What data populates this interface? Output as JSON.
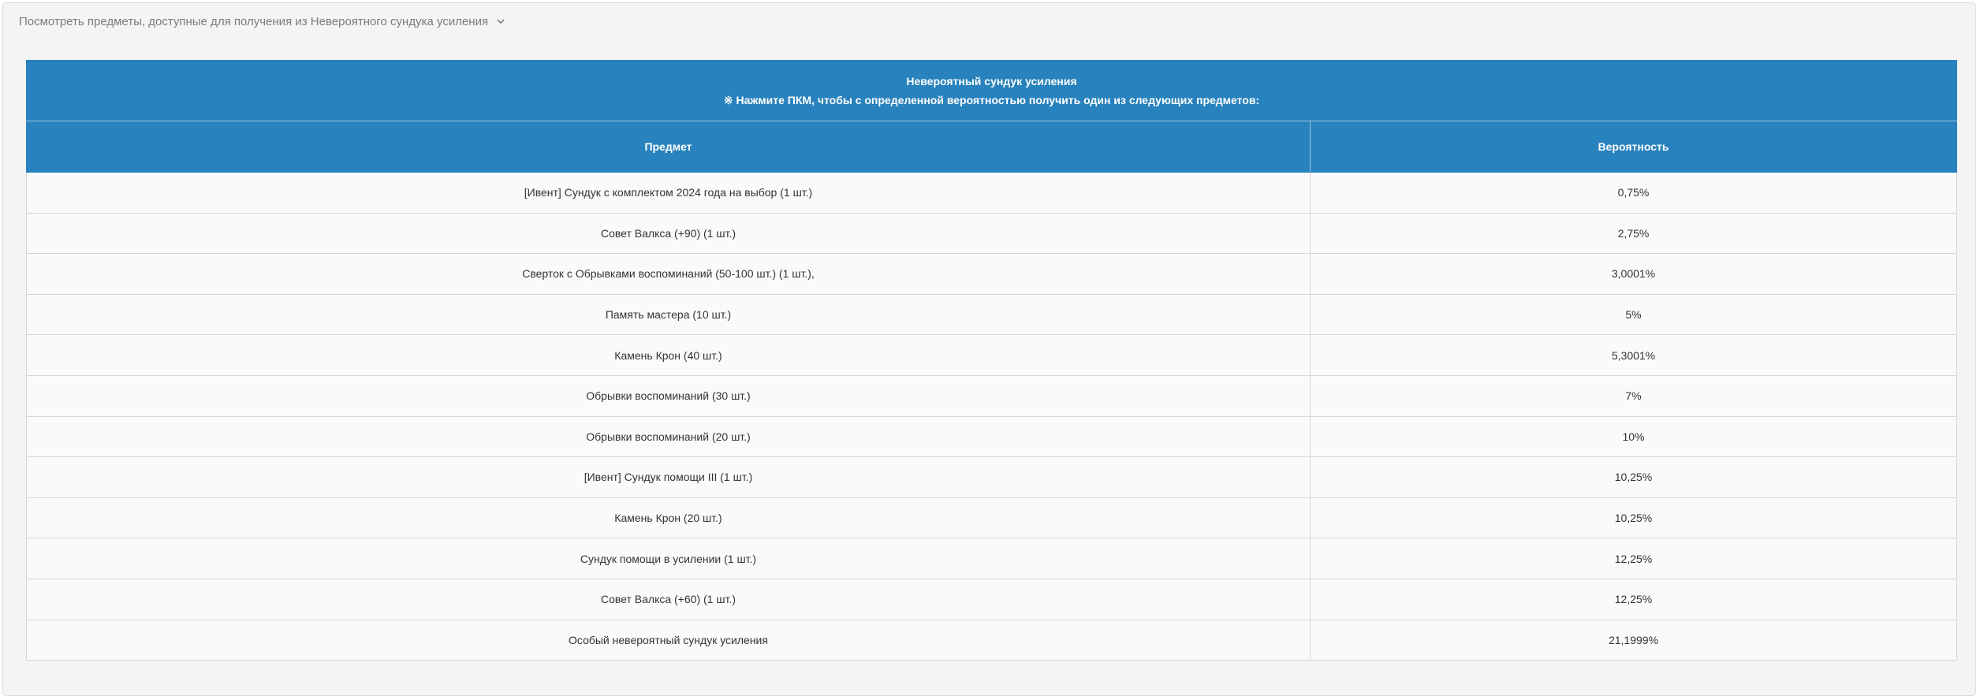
{
  "toggle": {
    "label": "Посмотреть предметы, доступные для получения из Невероятного сундука усиления",
    "icon": "chevron-down-icon"
  },
  "table": {
    "title": "Невероятный сундук усиления",
    "subtitle": "※ Нажмите ПКМ, чтобы с определенной вероятностью получить один из следующих предметов:",
    "columns": [
      "Предмет",
      "Вероятность"
    ],
    "rows": [
      {
        "item": "[Ивент] Сундук с комплектом 2024 года на выбор (1 шт.)",
        "prob": "0,75%"
      },
      {
        "item": "Совет Валкса (+90) (1 шт.)",
        "prob": "2,75%"
      },
      {
        "item": "Сверток с Обрывками воспоминаний (50-100 шт.) (1 шт.),",
        "prob": "3,0001%"
      },
      {
        "item": "Память мастера (10 шт.)",
        "prob": "5%"
      },
      {
        "item": "Камень Крон (40 шт.)",
        "prob": "5,3001%"
      },
      {
        "item": "Обрывки воспоминаний (30 шт.)",
        "prob": "7%"
      },
      {
        "item": "Обрывки воспоминаний (20 шт.)",
        "prob": "10%"
      },
      {
        "item": "[Ивент] Сундук помощи III (1 шт.)",
        "prob": "10,25%"
      },
      {
        "item": "Камень Крон (20 шт.)",
        "prob": "10,25%"
      },
      {
        "item": "Сундук помощи в усилении (1 шт.)",
        "prob": "12,25%"
      },
      {
        "item": "Совет Валкса (+60) (1 шт.)",
        "prob": "12,25%"
      },
      {
        "item": "Особый невероятный сундук усиления",
        "prob": "21,1999%"
      }
    ]
  },
  "colors": {
    "header_bg": "#2882bd",
    "panel_bg": "#f4f4f4",
    "row_bg": "#fafafa"
  }
}
